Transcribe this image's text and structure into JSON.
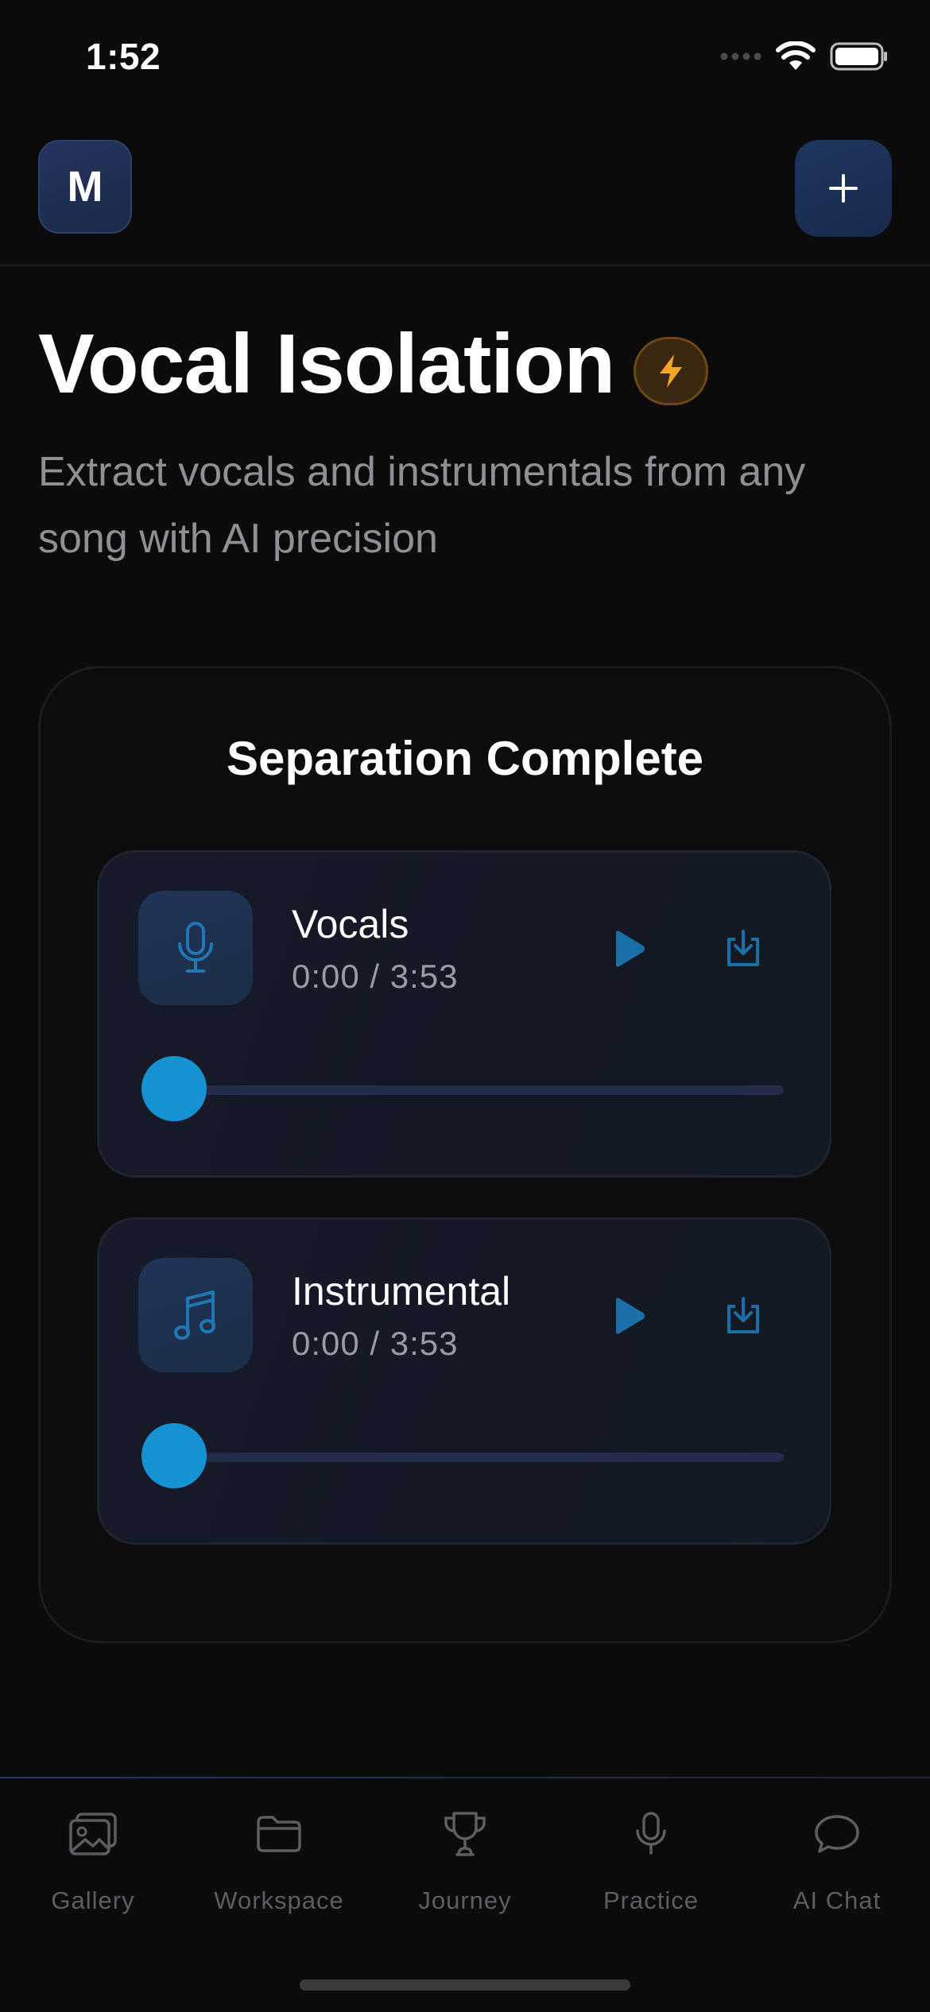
{
  "status_bar": {
    "time": "1:52"
  },
  "header": {
    "avatar_initial": "M"
  },
  "page": {
    "title": "Vocal Isolation",
    "subtitle": "Extract vocals and instrumentals from any song with AI precision"
  },
  "result": {
    "title": "Separation Complete",
    "tracks": [
      {
        "name": "Vocals",
        "time": "0:00 / 3:53",
        "progress": 0,
        "icon": "microphone-icon"
      },
      {
        "name": "Instrumental",
        "time": "0:00 / 3:53",
        "progress": 0,
        "icon": "music-note-icon"
      }
    ]
  },
  "tabbar": {
    "items": [
      {
        "label": "Gallery",
        "icon": "gallery-icon"
      },
      {
        "label": "Workspace",
        "icon": "folder-icon"
      },
      {
        "label": "Journey",
        "icon": "trophy-icon"
      },
      {
        "label": "Practice",
        "icon": "microphone-icon"
      },
      {
        "label": "AI Chat",
        "icon": "chat-bubble-icon"
      }
    ]
  },
  "colors": {
    "background": "#0b0b0c",
    "accent_blue": "#1592d2",
    "bolt_orange": "#f5a524",
    "muted_text": "#8f8f95"
  }
}
